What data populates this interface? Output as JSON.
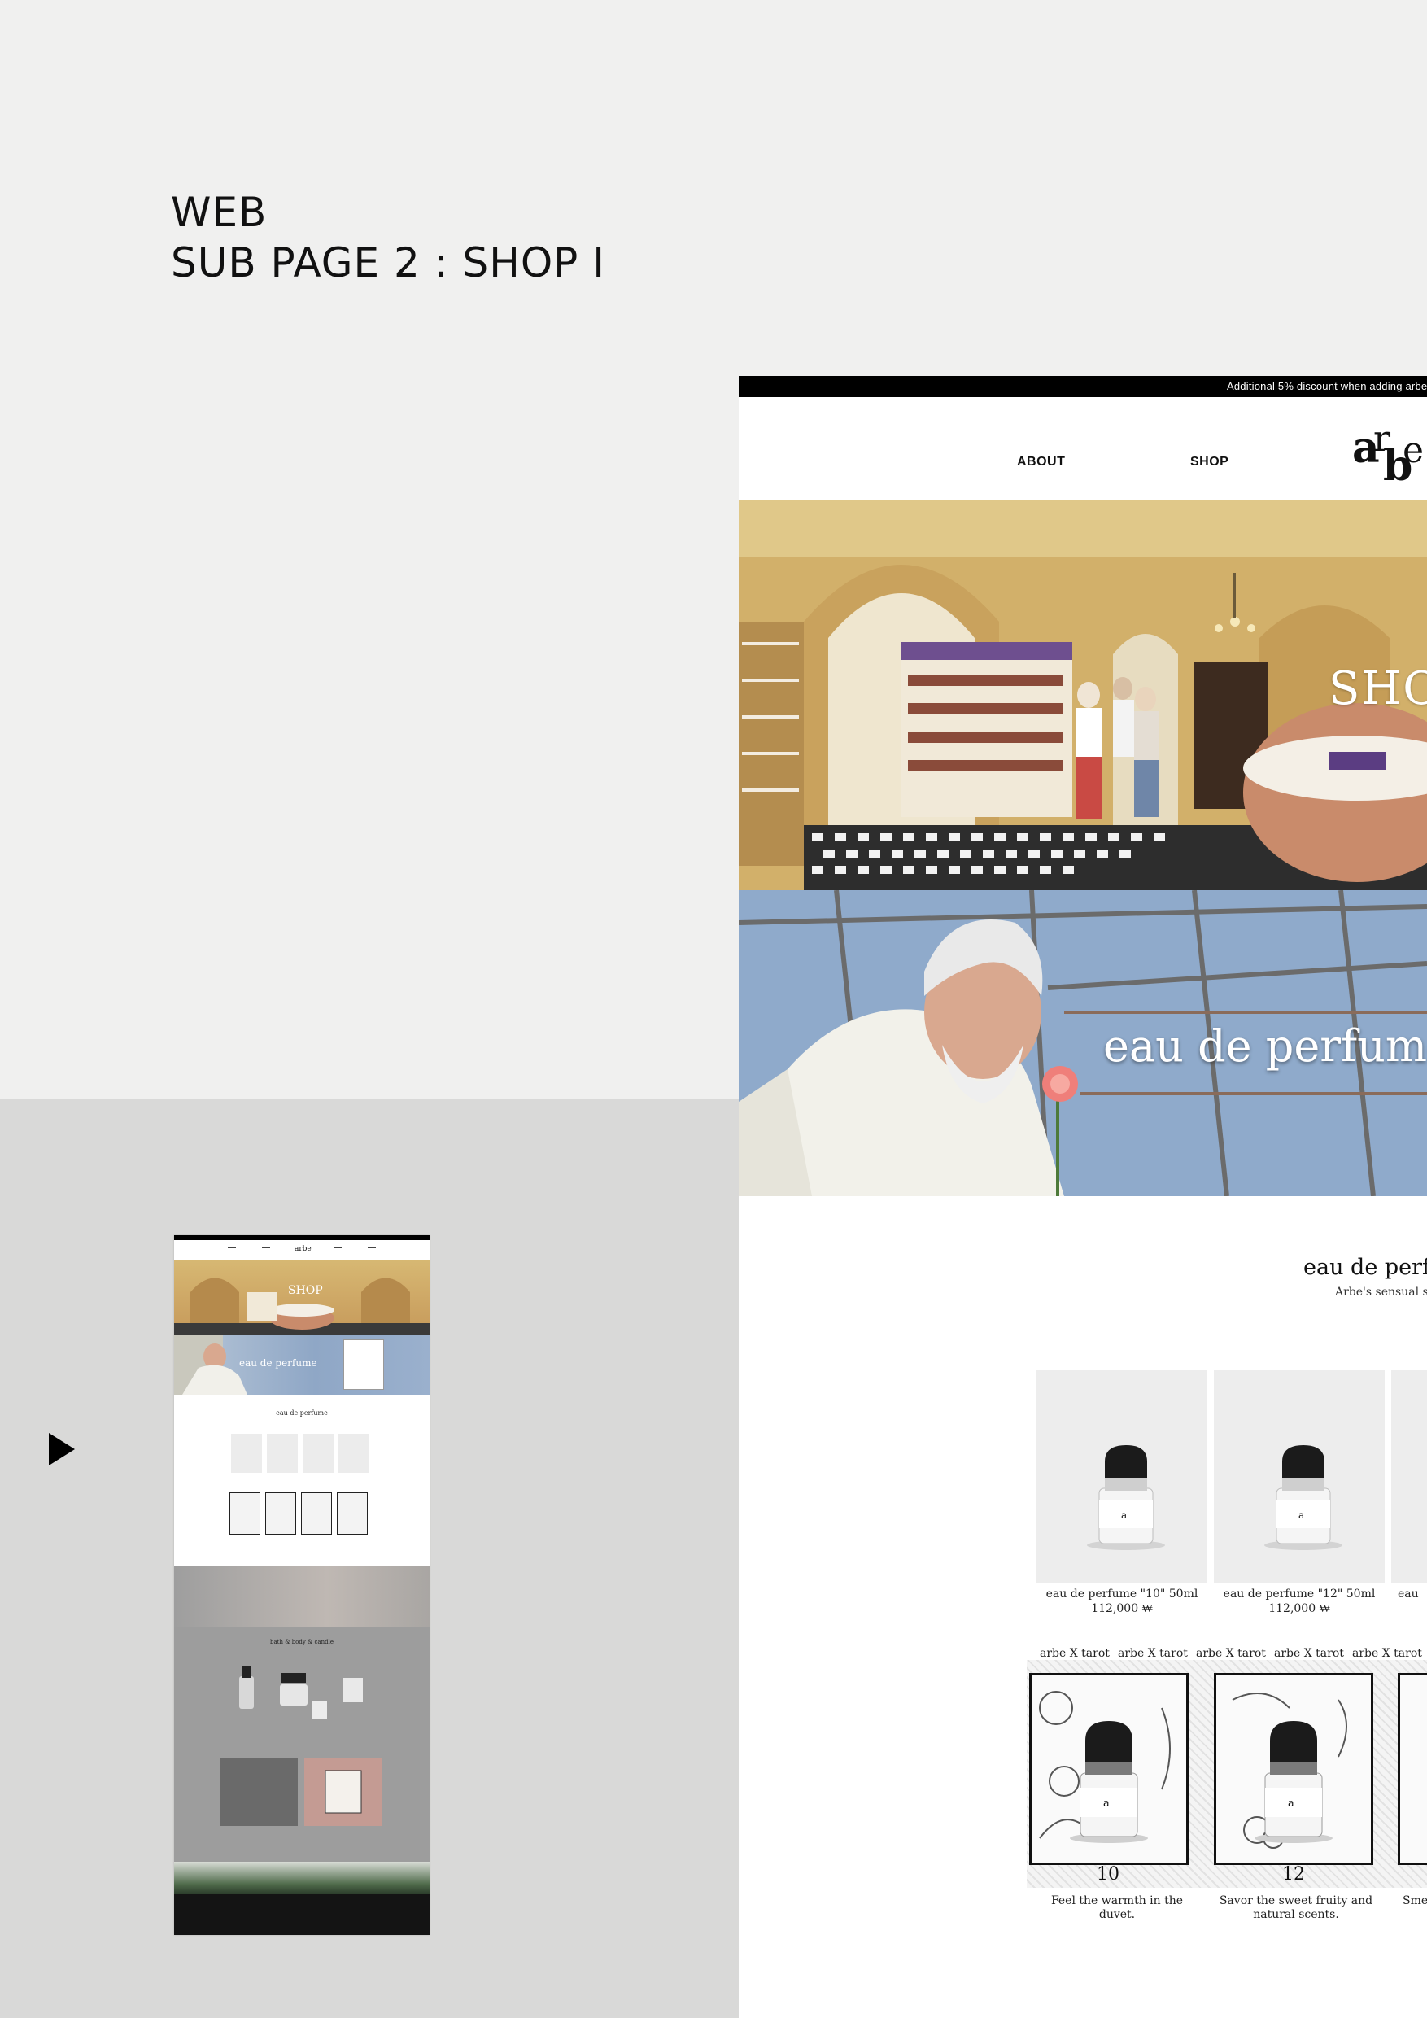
{
  "heading": {
    "line1": "WEB",
    "line2": "SUB PAGE 2 : SHOP I"
  },
  "site": {
    "promo_text": "Additional 5% discount when adding arbe",
    "nav": {
      "about": "ABOUT",
      "shop": "SHOP"
    },
    "logo_alt": "arbe logo",
    "hero": {
      "title": "SHOP"
    },
    "banner": {
      "title": "eau de perfume"
    },
    "section": {
      "title": "eau de perfume",
      "subtitle": "Arbe's sensual sc"
    },
    "products": [
      {
        "name": "eau de perfume \"10\" 50ml",
        "price": "112,000 ₩"
      },
      {
        "name": "eau de perfume \"12\" 50ml",
        "price": "112,000 ₩"
      },
      {
        "name": "eau",
        "price": ""
      }
    ],
    "tarot": {
      "labels": [
        "arbe X tarot",
        "arbe X tarot",
        "arbe X tarot",
        "arbe X tarot",
        "arbe X tarot"
      ],
      "cards": [
        {
          "number": "10",
          "desc": "Feel the warmth in the duvet."
        },
        {
          "number": "12",
          "desc": "Savor the sweet fruity and natural scents."
        },
        {
          "number": "",
          "desc": "Sme"
        }
      ]
    }
  },
  "thumbnail": {
    "logo": "arbe",
    "hero_title": "SHOP",
    "banner_title": "eau de perfume",
    "section_title": "eau de perfume",
    "section2_title": "bath & body & candle"
  },
  "colors": {
    "page_top": "#f0f0ef",
    "page_bottom": "#d9d9d8",
    "promo_bar": "#000000",
    "hero_gold": "#cfa95f",
    "banner_blue": "#9db6d3"
  },
  "icons": {
    "play": "play-triangle-icon"
  }
}
